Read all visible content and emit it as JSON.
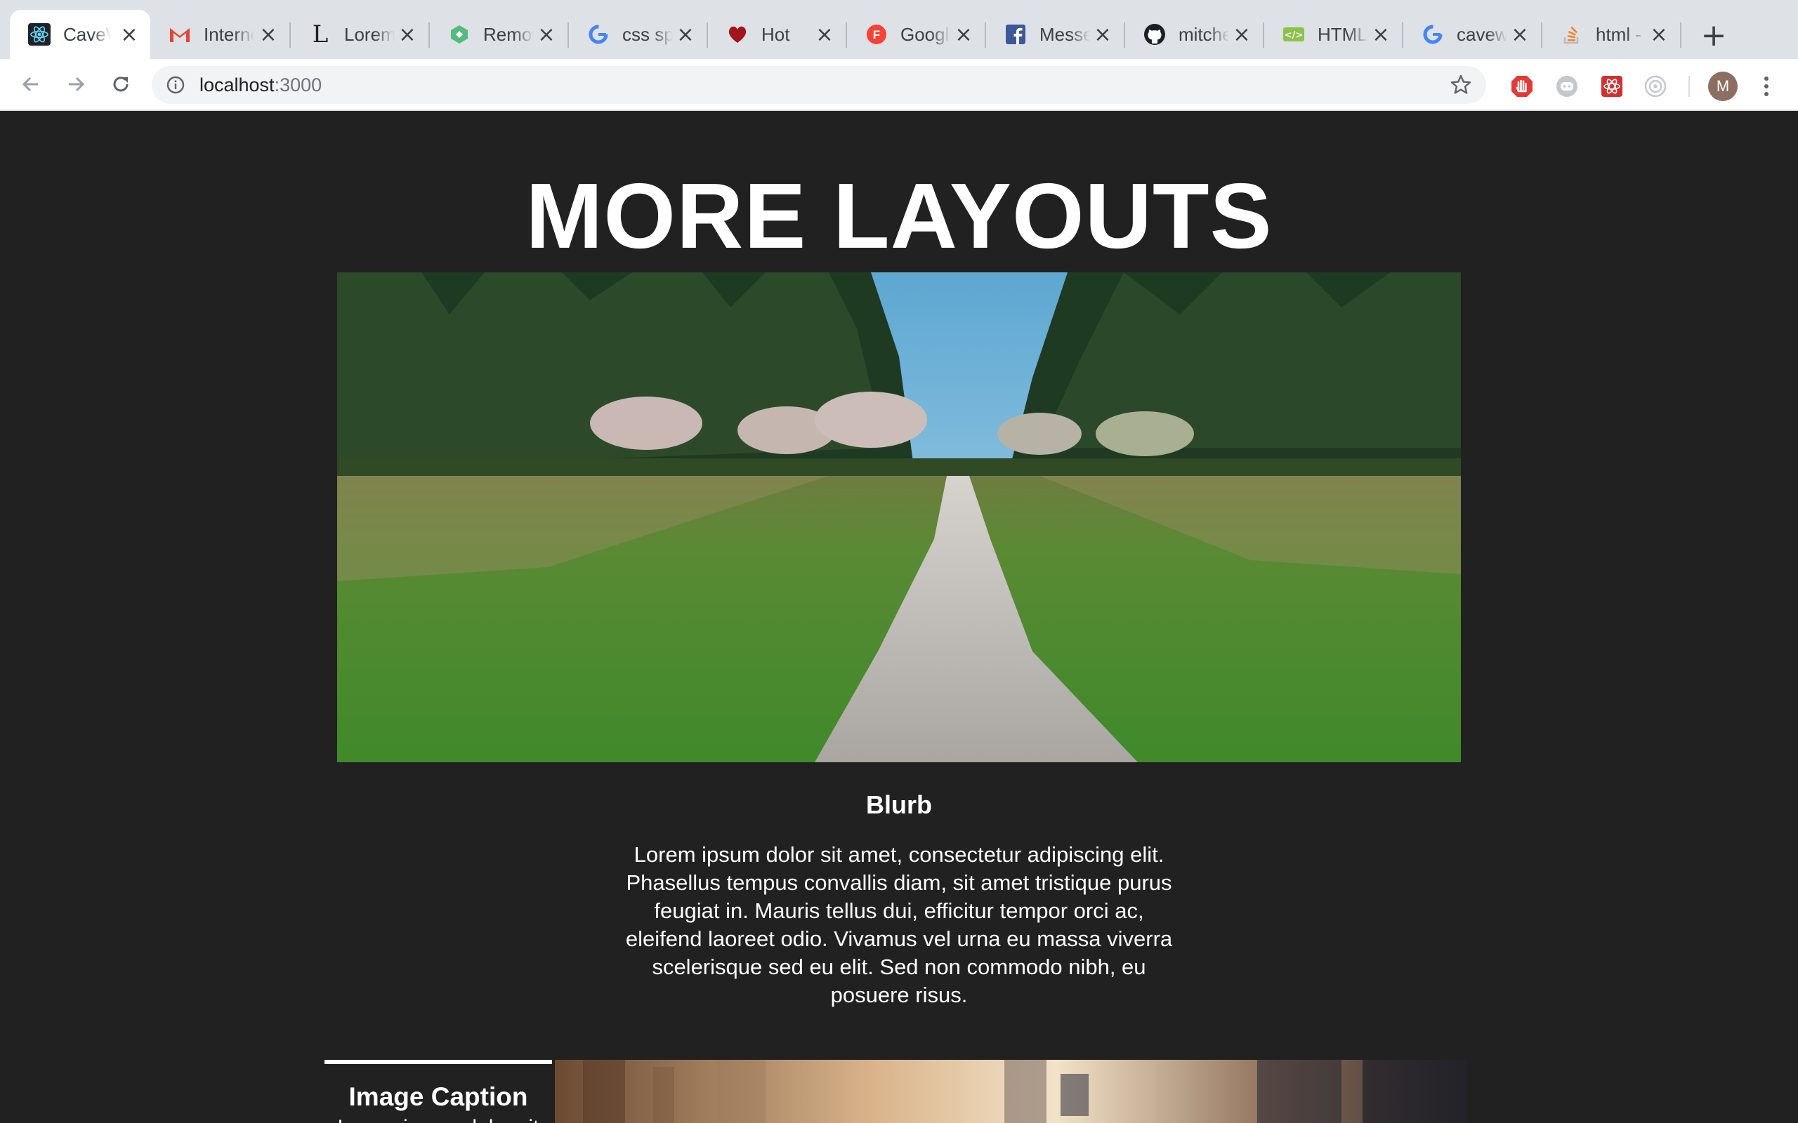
{
  "browser": {
    "tabs": [
      {
        "title": "CaveWeb",
        "icon": "react-icon",
        "active": true
      },
      {
        "title": "Internet Inbox",
        "icon": "gmail-icon"
      },
      {
        "title": "Lorem Ipsum",
        "icon": "lipsum-icon"
      },
      {
        "title": "Remove",
        "icon": "remove-bg-icon"
      },
      {
        "title": "css spacing",
        "icon": "google-icon"
      },
      {
        "title": "Hot",
        "icon": "heart-icon"
      },
      {
        "title": "Google Fonts",
        "icon": "google-fonts-icon"
      },
      {
        "title": "Messenger",
        "icon": "facebook-icon"
      },
      {
        "title": "mitchell",
        "icon": "github-icon"
      },
      {
        "title": "HTML",
        "icon": "html-icon"
      },
      {
        "title": "caveweb",
        "icon": "google-icon"
      },
      {
        "title": "html -",
        "icon": "stackoverflow-icon"
      }
    ],
    "address": {
      "host": "localhost",
      "port": ":3000"
    },
    "profile_initial": "M"
  },
  "page": {
    "title": "MORE LAYOUTS",
    "blurb_title": "Blurb",
    "blurb_text": "Lorem ipsum dolor sit amet, consectetur adipiscing elit. Phasellus tempus convallis diam, sit amet tristique purus feugiat in. Mauris tellus dui, efficitur tempor orci ac, eleifend laoreet odio. Vivamus vel urna eu massa viverra scelerisque sed eu elit. Sed non commodo nibh, eu posuere risus.",
    "caption_title": "Image Caption",
    "caption_sub": "Lorem ipsum dolor sit"
  }
}
